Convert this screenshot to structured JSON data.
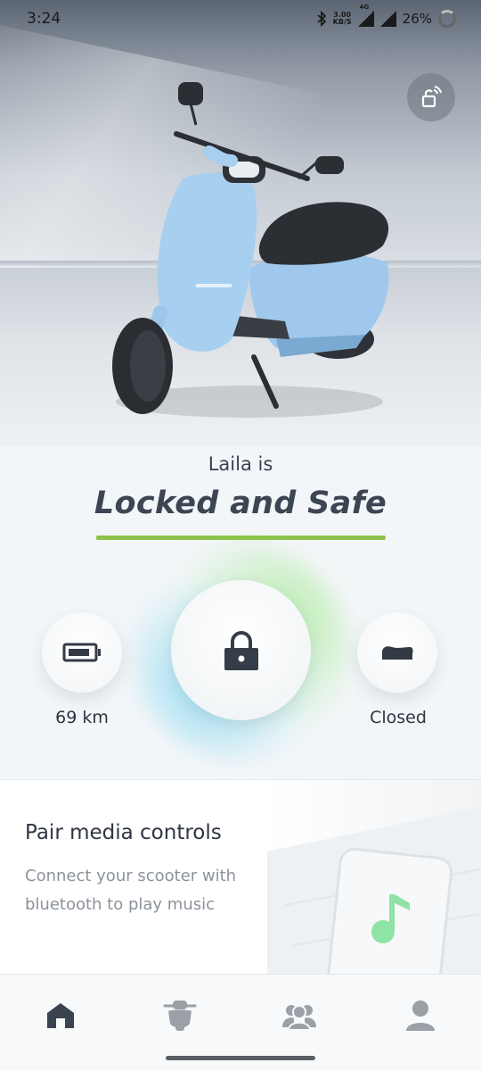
{
  "status_bar": {
    "time": "3:24",
    "net_speed_value": "3.00",
    "net_speed_unit": "KB/S",
    "network_type": "4G",
    "battery_percent": "26%",
    "icons": [
      "bluetooth-icon",
      "signal-icon",
      "signal-icon",
      "battery-ring-icon"
    ]
  },
  "hero": {
    "owner_line": "Laila is",
    "status_title": "Locked and Safe",
    "accent_color": "#8cc34a"
  },
  "controls": {
    "range_label": "69 km",
    "seat_label": "Closed",
    "icons": {
      "range": "battery-icon",
      "lock": "padlock-icon",
      "seat": "seat-icon",
      "top": "lock-signal-icon"
    }
  },
  "card": {
    "title": "Pair media controls",
    "description": "Connect your scooter with bluetooth to play music",
    "art_icon": "music-note-icon"
  },
  "bottom_nav": {
    "items": [
      {
        "name": "home",
        "icon": "home-icon",
        "active": true
      },
      {
        "name": "scooter",
        "icon": "scooter-icon",
        "active": false
      },
      {
        "name": "community",
        "icon": "community-icon",
        "active": false
      },
      {
        "name": "profile",
        "icon": "profile-icon",
        "active": false
      }
    ]
  },
  "colors": {
    "text_dark": "#3c4552",
    "green_accent": "#8cc34a",
    "music_green": "#8fe3a5",
    "nav_active": "#3a4451",
    "nav_inactive": "#9aa0a6"
  }
}
